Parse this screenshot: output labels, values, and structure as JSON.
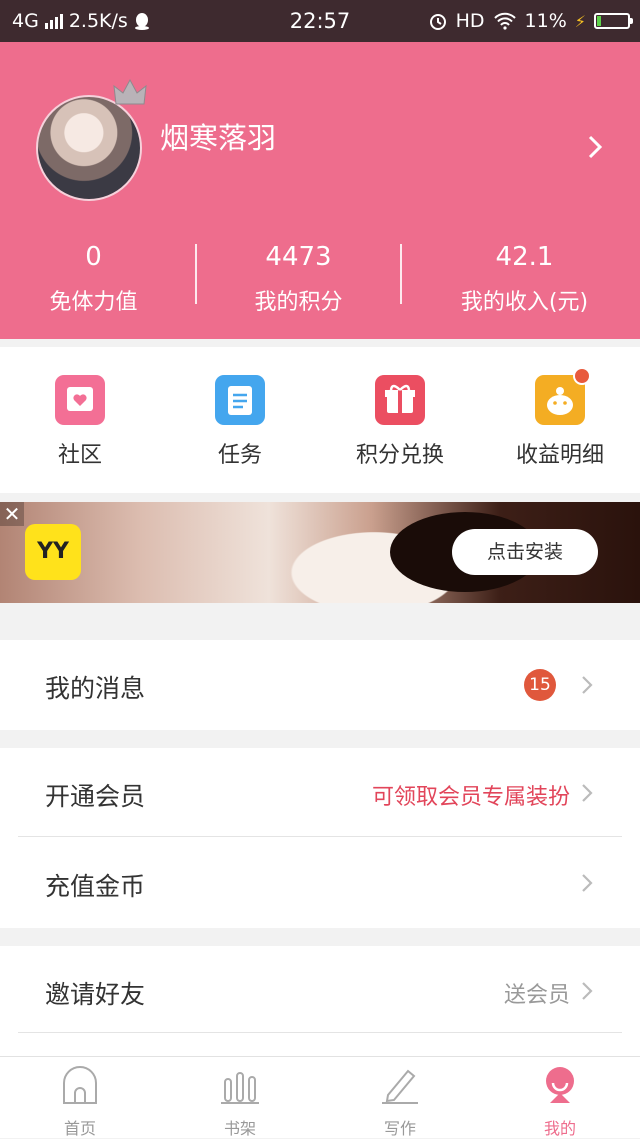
{
  "status_bar": {
    "network": "4G",
    "speed": "2.5K/s",
    "time": "22:57",
    "hd": "HD",
    "battery": "11%"
  },
  "profile": {
    "username": "烟寒落羽",
    "stats": [
      {
        "value": "0",
        "label": "免体力值"
      },
      {
        "value": "4473",
        "label": "我的积分"
      },
      {
        "value": "42.1",
        "label": "我的收入(元)"
      }
    ]
  },
  "quick_actions": [
    {
      "label": "社区",
      "icon": "community-icon",
      "color": "#f36f95"
    },
    {
      "label": "任务",
      "icon": "task-list-icon",
      "color": "#44a6ee"
    },
    {
      "label": "积分兑换",
      "icon": "gift-icon",
      "color": "#eb4e61"
    },
    {
      "label": "收益明细",
      "icon": "piggy-bank-icon",
      "color": "#f4ad23"
    }
  ],
  "ad": {
    "logo_text": "YY",
    "button_label": "点击安装"
  },
  "menu": {
    "messages": {
      "title": "我的消息",
      "badge": "15"
    },
    "vip": {
      "title": "开通会员",
      "note": "可领取会员专属装扮"
    },
    "recharge": {
      "title": "充值金币"
    },
    "invite": {
      "title": "邀请好友",
      "note": "送会员"
    }
  },
  "tabs": [
    {
      "label": "首页",
      "icon": "home-icon"
    },
    {
      "label": "书架",
      "icon": "bookshelf-icon"
    },
    {
      "label": "写作",
      "icon": "pen-icon"
    },
    {
      "label": "我的",
      "icon": "profile-icon"
    }
  ],
  "colors": {
    "brand": "#ee6d8d",
    "accent_text": "#e2455a",
    "badge": "#e0583c"
  }
}
